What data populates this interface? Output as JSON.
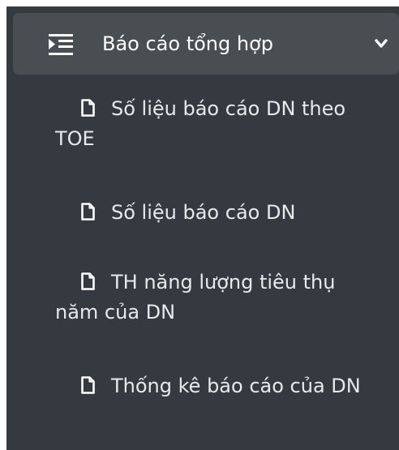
{
  "menu": {
    "group_title": "Báo cáo tổng hợp",
    "group_icon": "indent-list-icon",
    "toggle_icon": "chevron-down-icon",
    "items": [
      {
        "label": "Số liệu báo cáo DN theo TOE",
        "icon": "file-icon"
      },
      {
        "label": "Số liệu báo cáo DN",
        "icon": "file-icon"
      },
      {
        "label": "TH năng lượng tiêu thụ năm của DN",
        "icon": "file-icon"
      },
      {
        "label": "Thống kê báo cáo của DN",
        "icon": "file-icon"
      }
    ]
  },
  "colors": {
    "sidebar_bg": "#343a40",
    "header_bg": "#494e53",
    "text": "#ffffff",
    "item_text": "#e8e9ea"
  }
}
